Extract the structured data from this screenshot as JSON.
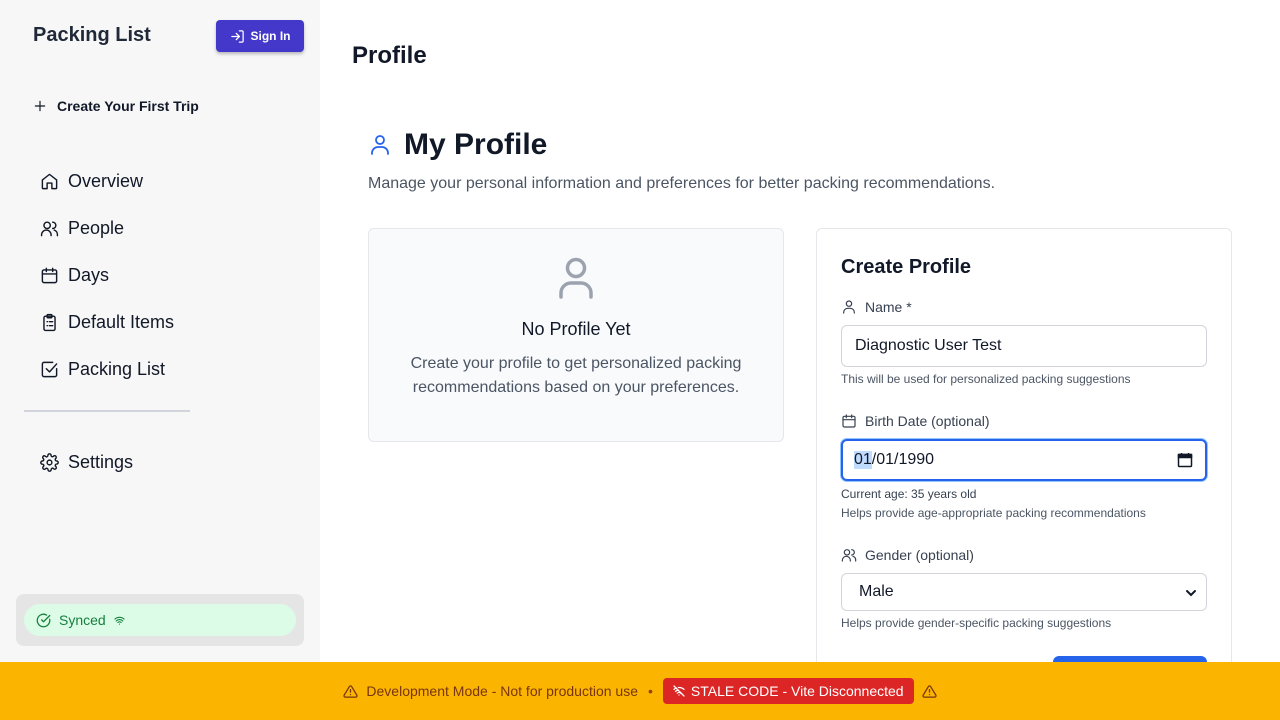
{
  "sidebar": {
    "app_title": "Packing List",
    "sign_in_label": "Sign In",
    "create_trip_label": "Create Your First Trip",
    "items": [
      {
        "label": "Overview",
        "icon": "home-icon"
      },
      {
        "label": "People",
        "icon": "users-icon"
      },
      {
        "label": "Days",
        "icon": "calendar-icon"
      },
      {
        "label": "Default Items",
        "icon": "clipboard-list-icon"
      },
      {
        "label": "Packing List",
        "icon": "check-square-icon"
      }
    ],
    "settings_label": "Settings",
    "sync_status": "Synced"
  },
  "main": {
    "page_title": "Profile",
    "profile_heading": "My Profile",
    "profile_description": "Manage your personal information and preferences for better packing recommendations.",
    "empty_state": {
      "title": "No Profile Yet",
      "text": "Create your profile to get personalized packing recommendations based on your preferences."
    },
    "form": {
      "title": "Create Profile",
      "name_label": "Name *",
      "name_value": "Diagnostic User Test",
      "name_hint": "This will be used for personalized packing suggestions",
      "birth_label": "Birth Date (optional)",
      "birth_month": "01",
      "birth_rest": "/01/1990",
      "current_age": "Current age: 35 years old",
      "birth_hint": "Helps provide age-appropriate packing recommendations",
      "gender_label": "Gender (optional)",
      "gender_value": "Male",
      "gender_hint": "Helps provide gender-specific packing suggestions"
    }
  },
  "dev_banner": {
    "text": "Development Mode - Not for production use",
    "separator": "•",
    "stale_label": "STALE CODE - Vite Disconnected"
  },
  "colors": {
    "accent": "#4338ca",
    "primary_blue": "#2563eb",
    "banner": "#fbb500",
    "stale": "#dc2626",
    "synced": "#15803d"
  }
}
